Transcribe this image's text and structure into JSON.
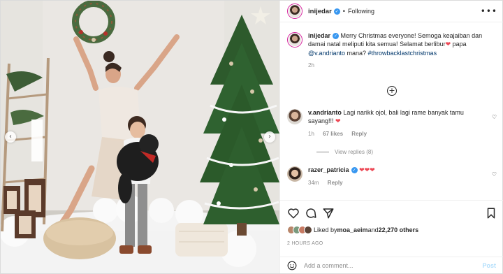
{
  "photo": {
    "alt_icons": {
      "prev": "chevron-left-icon",
      "next": "chevron-right-icon"
    },
    "prev_glyph": "‹",
    "next_glyph": "›"
  },
  "header": {
    "username": "inijedar",
    "separator": "•",
    "follow_status": "Following",
    "more_glyph": "•••"
  },
  "caption": {
    "username": "inijedar",
    "text_before_heart": " Merry Christmas everyone! Semoga keajaiban dan damai natal meliputi kita semua! Selamat berlibur",
    "heart": "❤",
    "text_after_heart": " papa ",
    "mention": "@v.andrianto",
    "text_tail": " mana? ",
    "hashtag": "#throwbacklastchristmas",
    "time": "2h"
  },
  "comments": [
    {
      "username": "v.andrianto",
      "text": " Lagi narikk ojol, bali lagi rame banyak tamu sayang!!! ",
      "heart": "❤",
      "time": "1h",
      "likes": "67 likes",
      "reply": "Reply",
      "view_replies": "View replies (8)"
    },
    {
      "username": "razer_patricia",
      "hearts": "❤❤❤",
      "time": "34m",
      "reply": "Reply"
    }
  ],
  "actions": {
    "liked_by_prefix": "Liked by ",
    "liked_by_user": "moa_aeim",
    "liked_by_mid": " and ",
    "liked_by_count": "22,270 others",
    "posted_ago": "2 HOURS AGO"
  },
  "add_comment": {
    "placeholder": "Add a comment...",
    "post_label": "Post"
  },
  "colors": {
    "verified": "#3897f0",
    "link": "#00376b",
    "heart": "#ed4956",
    "muted": "#8e8e8e"
  }
}
